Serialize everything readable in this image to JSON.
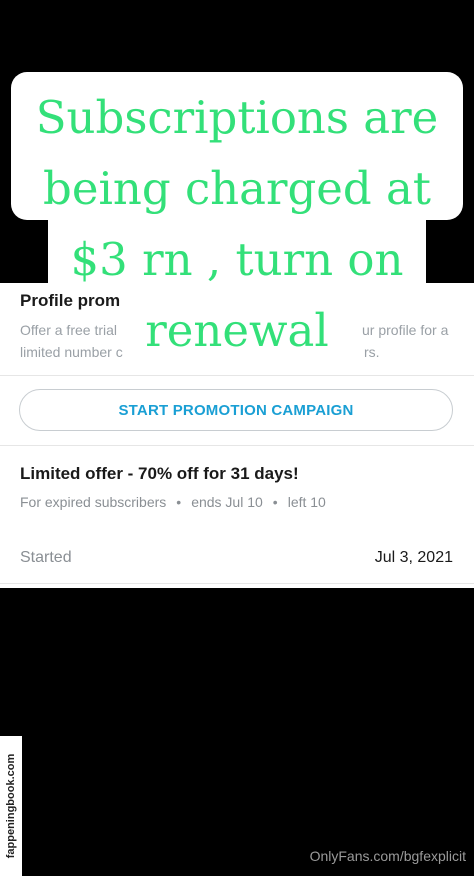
{
  "promotion": {
    "title": "Profile prom",
    "desc_line1_left": "Offer a free trial",
    "desc_line1_right": "ur profile for a",
    "desc_line2_left": "limited number c",
    "desc_line2_right": "rs.",
    "button_label": "START PROMOTION CAMPAIGN"
  },
  "offer": {
    "title": "Limited offer - 70% off for 31 days!",
    "audience": "For expired subscribers",
    "ends": "ends Jul 10",
    "left": "left 10",
    "started_label": "Started",
    "started_date": "Jul 3, 2021"
  },
  "overlay": {
    "line1": "Subscriptions are",
    "line2": "being charged at",
    "line3": "$3 rn , turn on",
    "line4": "renewal"
  },
  "watermarks": {
    "side": "fappeningbook.com",
    "bottom": "OnlyFans.com/bgfexplicit"
  },
  "colors": {
    "overlay_text": "#33e079",
    "button_text": "#1a9fd4",
    "background": "#000000"
  }
}
